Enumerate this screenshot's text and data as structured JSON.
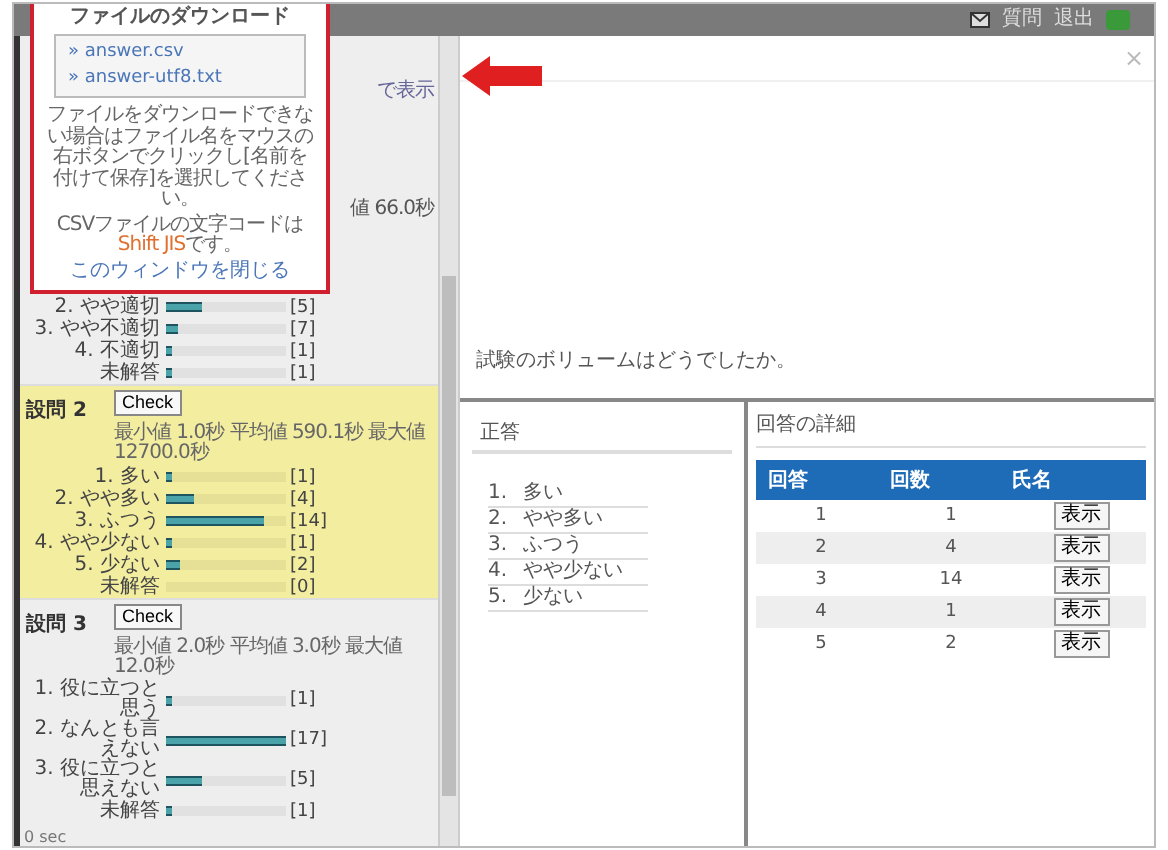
{
  "top_bar": {
    "links": [
      "質問",
      "退出"
    ]
  },
  "download_popup": {
    "title": "ファイルのダウンロード",
    "files": [
      "» answer.csv",
      "» answer-utf8.txt"
    ],
    "note": "ファイルをダウンロードできない場合はファイル名をマウスの右ボタンでクリックし[名前を付けて保存]を選択してください。",
    "charset_note": [
      "CSVファイルの文字コードは",
      "Shift JIS",
      "です。"
    ],
    "close_link": "このウィンドウを閉じる"
  },
  "left_panel": {
    "hidden_fragments": [
      "で表示",
      "値 66.0秒"
    ],
    "questions": [
      {
        "highlighted": false,
        "options": [
          {
            "label": "2. やや適切",
            "count": "[5]",
            "level": 0.3
          },
          {
            "label": "3. やや不適切",
            "count": "[7]",
            "level": 0.1
          },
          {
            "label": "4. 不適切",
            "count": "[1]",
            "level": 0.05
          },
          {
            "label": "未解答",
            "count": "[1]",
            "level": 0.05
          }
        ]
      },
      {
        "highlighted": true,
        "title": "設問 2",
        "check_label": "Check",
        "stats": "最小値 1.0秒 平均値 590.1秒 最大値 12700.0秒",
        "options": [
          {
            "label": "1. 多い",
            "count": "[1]",
            "level": 0.05
          },
          {
            "label": "2. やや多い",
            "count": "[4]",
            "level": 0.24
          },
          {
            "label": "3. ふつう",
            "count": "[14]",
            "level": 0.82
          },
          {
            "label": "4. やや少ない",
            "count": "[1]",
            "level": 0.05
          },
          {
            "label": "5. 少ない",
            "count": "[2]",
            "level": 0.12
          },
          {
            "label": "未解答",
            "count": "[0]",
            "level": 0
          }
        ]
      },
      {
        "highlighted": false,
        "title": "設問 3",
        "check_label": "Check",
        "stats": "最小値 2.0秒 平均値 3.0秒 最大値 12.0秒",
        "options": [
          {
            "label": "1. 役に立つと思う",
            "count": "[1]",
            "level": 0.05
          },
          {
            "label": "2. なんとも言えない",
            "count": "[17]",
            "level": 1
          },
          {
            "label": "3. 役に立つと思えない",
            "count": "[5]",
            "level": 0.3
          },
          {
            "label": "未解答",
            "count": "[1]",
            "level": 0.05
          }
        ]
      }
    ],
    "footer": "0 sec"
  },
  "modal": {
    "close": "×",
    "question": "試験のボリュームはどうでしたか。",
    "answers_title": "正答",
    "answers": [
      {
        "number": "1.",
        "text": "多い"
      },
      {
        "number": "2.",
        "text": "やや多い"
      },
      {
        "number": "3.",
        "text": "ふつう"
      },
      {
        "number": "4.",
        "text": "やや少ない"
      },
      {
        "number": "5.",
        "text": "少ない"
      }
    ],
    "details_title": "回答の詳細",
    "table": {
      "columns": [
        "回答",
        "回数",
        "氏名"
      ],
      "rows": [
        {
          "cells": [
            "1",
            "1"
          ],
          "button": "表示"
        },
        {
          "cells": [
            "2",
            "4"
          ],
          "button": "表示"
        },
        {
          "cells": [
            "3",
            "14"
          ],
          "button": "表示"
        },
        {
          "cells": [
            "4",
            "1"
          ],
          "button": "表示"
        },
        {
          "cells": [
            "5",
            "2"
          ],
          "button": "表示"
        }
      ]
    }
  }
}
